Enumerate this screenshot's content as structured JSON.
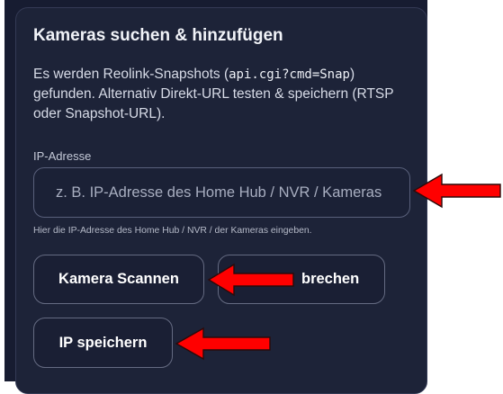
{
  "card": {
    "title": "Kameras suchen & hinzufügen",
    "description_before": "Es werden Reolink-Snapshots (",
    "description_code": "api.cgi?cmd=Snap",
    "description_after": ") gefunden. Alternativ Direkt-URL testen & speichern (RTSP oder Snapshot-URL).",
    "ip_field": {
      "label": "IP-Adresse",
      "placeholder": "z. B. IP-Adresse des Home Hub / NVR / Kameras",
      "value": "",
      "hint": "Hier die IP-Adresse des Home Hub / NVR / der Kameras eingeben."
    },
    "buttons": {
      "scan_label": "Kamera Scannen",
      "cancel_label": "brechen",
      "save_label": "IP speichern"
    }
  },
  "annotations": {
    "arrow_color": "#ff0000",
    "arrow_icon": "red-arrow-left"
  }
}
